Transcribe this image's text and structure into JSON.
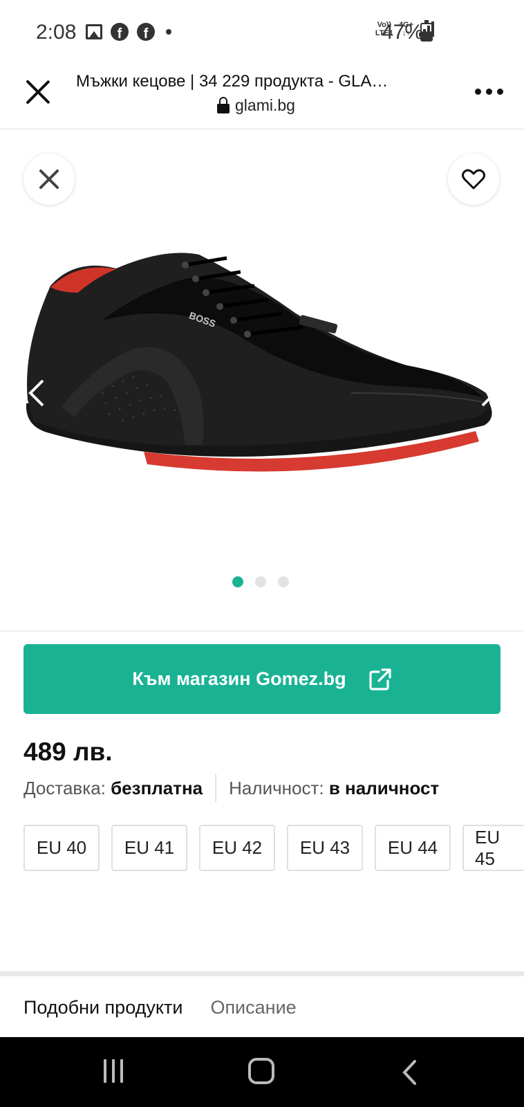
{
  "status_bar": {
    "time": "2:08",
    "left_icons": [
      "gallery-icon",
      "facebook-icon",
      "facebook-icon",
      "dot-icon"
    ],
    "volte_line1": "Vo))",
    "volte_line2": "LTE1",
    "network": "4G+",
    "battery": "47%"
  },
  "browser": {
    "title": "Мъжки кецове | 34 229 продукта - GLA…",
    "url": "glami.bg"
  },
  "gallery": {
    "image_alt": "Black BOSS sneaker with red sole",
    "brand_on_shoe": "BOSS",
    "slides_total": 3,
    "active_slide": 1
  },
  "shop_button": {
    "label": "Към магазин Gomez.bg"
  },
  "product": {
    "price": "489 лв.",
    "delivery_label": "Доставка:",
    "delivery_value": "безплатна",
    "availability_label": "Наличност:",
    "availability_value": "в наличност"
  },
  "sizes": [
    "EU 40",
    "EU 41",
    "EU 42",
    "EU 43",
    "EU 44",
    "EU 45"
  ],
  "tabs": [
    {
      "label": "Подобни продукти",
      "active": true
    },
    {
      "label": "Описание",
      "active": false
    }
  ],
  "colors": {
    "accent": "#19b394",
    "sole_red": "#d63a30"
  }
}
